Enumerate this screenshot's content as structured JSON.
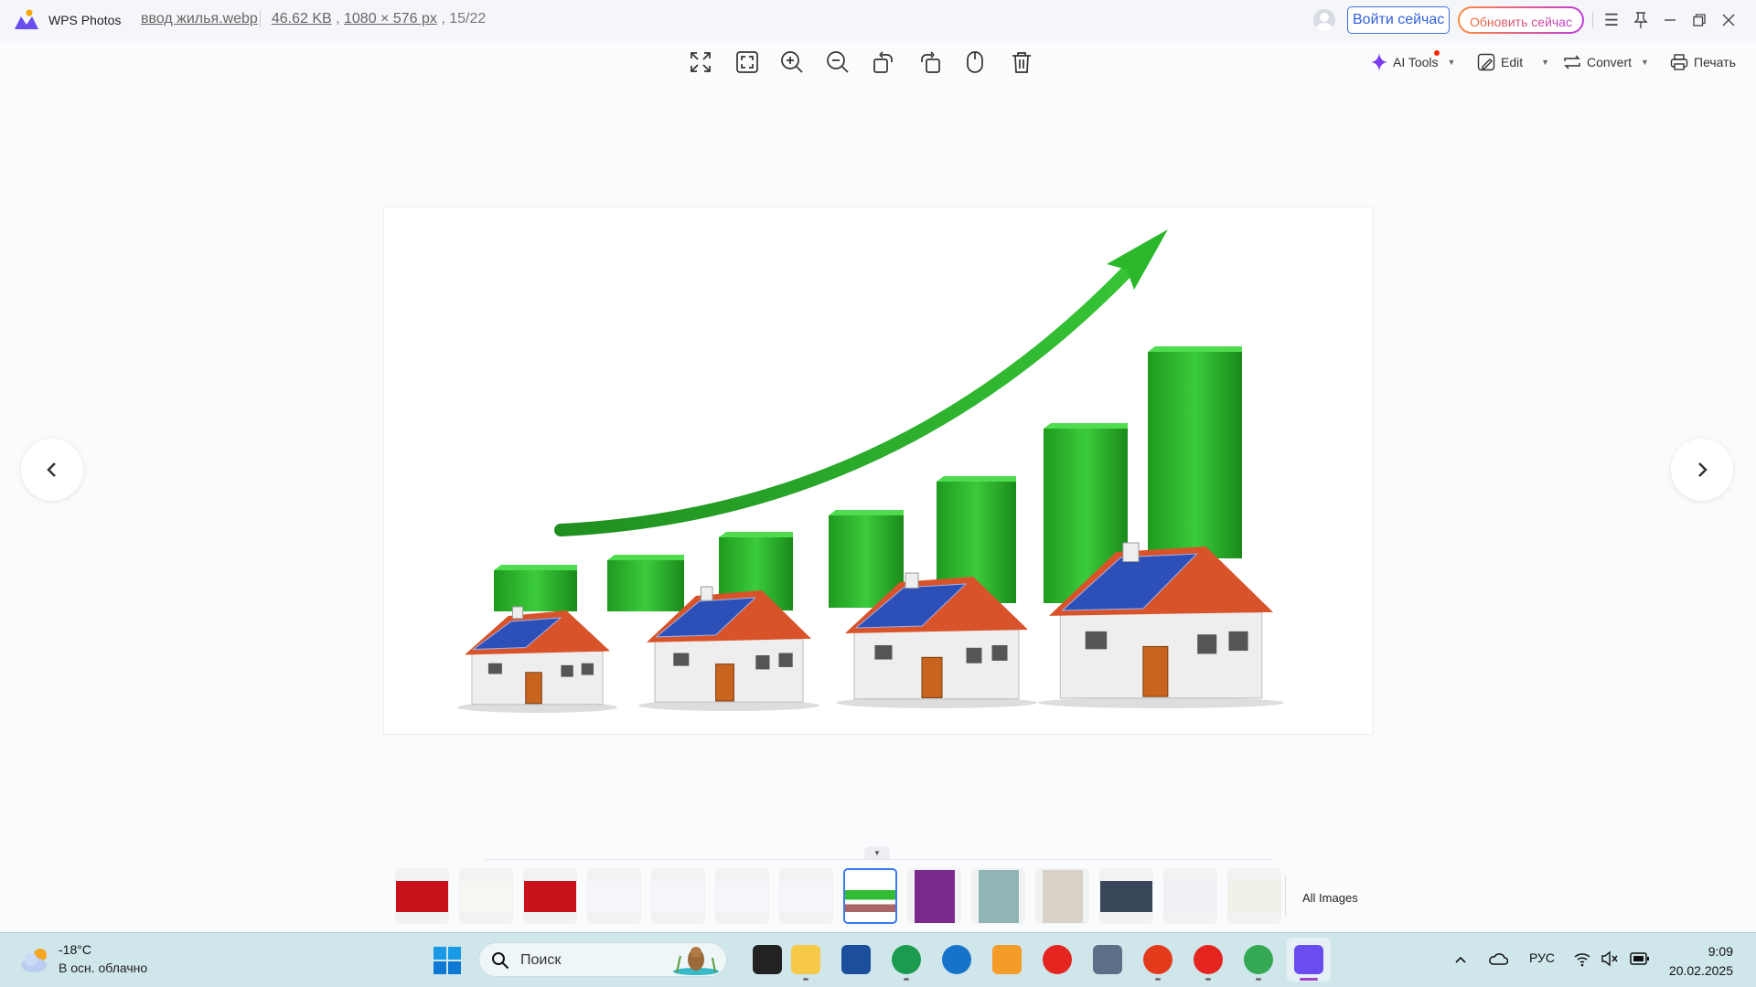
{
  "app": {
    "name": "WPS Photos"
  },
  "file": {
    "name": "ввод жилья.webp",
    "size": "46.62 KB",
    "dimensions": "1080 × 576 px",
    "position": "15/22"
  },
  "header": {
    "login_label": "Войти сейчас",
    "upgrade_label": "Обновить сейчас"
  },
  "toolbar": {
    "icons": [
      "fullscreen-icon",
      "fit-window-icon",
      "zoom-in-icon",
      "zoom-out-icon",
      "rotate-left-icon",
      "rotate-right-icon",
      "mouse-icon",
      "delete-icon"
    ],
    "ai_tools_label": "AI Tools",
    "edit_label": "Edit",
    "convert_label": "Convert",
    "print_label": "Печать"
  },
  "filmstrip": {
    "thumbnail_count": 14,
    "selected_index": 7,
    "all_images_label": "All Images"
  },
  "taskbar": {
    "weather_temp": "-18°C",
    "weather_desc": "В осн. облачно",
    "search_placeholder": "Поиск",
    "language": "РУС",
    "time": "9:09",
    "date": "20.02.2025"
  },
  "colors": {
    "accent": "#3a7af0",
    "bar_green": "#2fb52f",
    "roof": "#d9532a",
    "solar": "#2d4fb8"
  }
}
